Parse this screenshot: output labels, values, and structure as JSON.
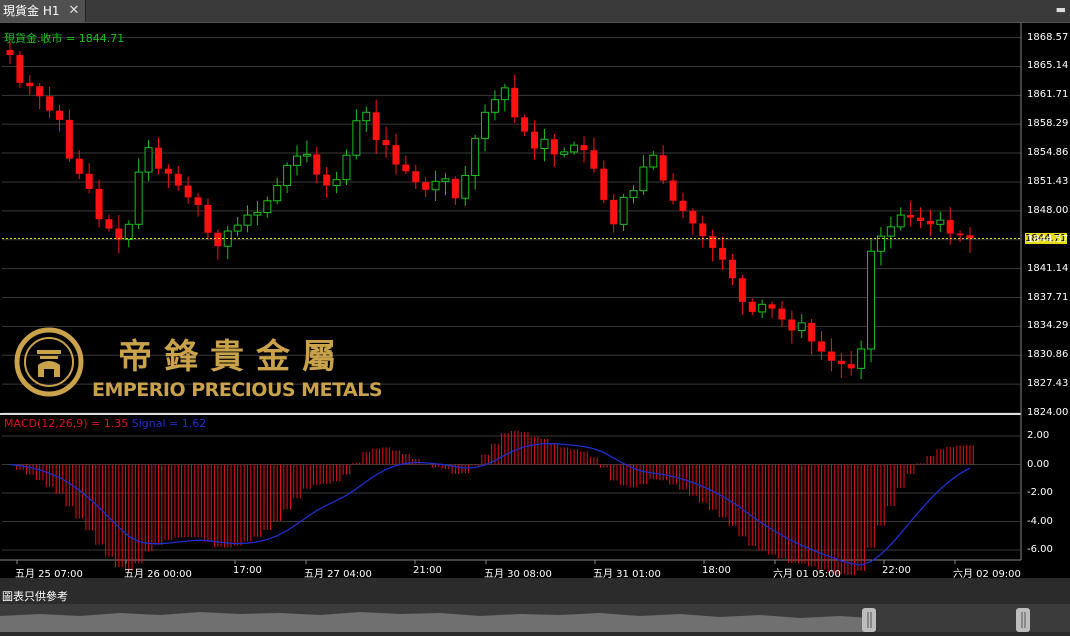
{
  "tab": {
    "title": "現貨金 H1",
    "close_glyph": "✕",
    "menu_glyph": "▬"
  },
  "chart": {
    "price_label": "現貨金.收市 = 1844.71",
    "current_price": "1844.71",
    "y_ticks": [
      "1868.57",
      "1865.14",
      "1861.71",
      "1858.29",
      "1854.86",
      "1851.43",
      "1848.00",
      "1844.57",
      "1841.14",
      "1837.71",
      "1834.29",
      "1830.86",
      "1827.43",
      "1824.00"
    ],
    "macd_label": "MACD(12,26,9) = 1.35",
    "signal_label": "Signal = 1.62",
    "macd_ticks": [
      "2.00",
      "0.00",
      "-2.00",
      "-4.00",
      "-6.00"
    ],
    "x_ticks": [
      "五月 25 07:00",
      "五月 26 00:00",
      "17:00",
      "五月 27 04:00",
      "21:00",
      "五月 30 08:00",
      "五月 31 01:00",
      "18:00",
      "六月 01 05:00",
      "22:00",
      "六月 02 09:00"
    ]
  },
  "chart_data": {
    "type": "candlestick",
    "symbol": "現貨金",
    "timeframe": "H1",
    "price_range": [
      1824.0,
      1870.3
    ],
    "close_path": [
      1866.5,
      1863.2,
      1862.8,
      1861.6,
      1859.9,
      1858.8,
      1854.2,
      1852.4,
      1850.6,
      1847.0,
      1845.9,
      1844.6,
      1846.4,
      1852.6,
      1855.5,
      1853.0,
      1852.4,
      1851.0,
      1849.6,
      1848.7,
      1845.4,
      1843.8,
      1845.6,
      1846.3,
      1847.5,
      1847.8,
      1849.2,
      1851.0,
      1853.4,
      1854.5,
      1854.7,
      1852.3,
      1851.0,
      1851.7,
      1854.6,
      1858.7,
      1859.7,
      1856.4,
      1855.8,
      1853.5,
      1852.7,
      1851.4,
      1850.5,
      1851.5,
      1851.8,
      1849.5,
      1852.2,
      1856.6,
      1859.7,
      1861.2,
      1862.6,
      1859.1,
      1857.4,
      1855.4,
      1856.5,
      1854.7,
      1855.0,
      1855.8,
      1855.2,
      1853.0,
      1849.3,
      1846.4,
      1849.6,
      1850.4,
      1853.2,
      1854.6,
      1851.6,
      1849.2,
      1848.0,
      1846.5,
      1845.0,
      1843.6,
      1842.2,
      1840.0,
      1837.2,
      1836.0,
      1836.9,
      1836.4,
      1835.1,
      1833.8,
      1834.7,
      1832.5,
      1831.3,
      1830.2,
      1829.8,
      1829.3,
      1831.6,
      1843.2,
      1845.0,
      1846.1,
      1847.5,
      1847.2,
      1846.8,
      1846.4,
      1846.9,
      1845.3,
      1845.1,
      1844.71
    ],
    "macd_value": 1.35,
    "signal_value": 1.62,
    "macd_range": [
      -6.0,
      2.0
    ],
    "logo_text": "EMPERIO PRECIOUS METALS",
    "logo_cn": "帝鋒貴金屬"
  },
  "footer": {
    "disclaimer": "圖表只供參考"
  },
  "colors": {
    "up": "#18c318",
    "down": "#ff1111",
    "signal": "#1d2fd0",
    "macd_bar": "#e0101a",
    "current": "#e6dd10",
    "logo": "#c9a24a"
  }
}
